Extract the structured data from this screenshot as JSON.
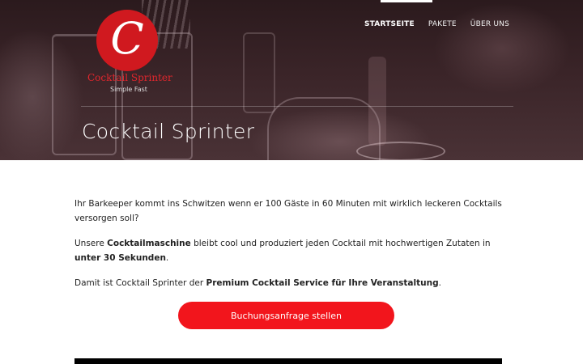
{
  "logo": {
    "letter": "C",
    "name": "Cocktail Sprinter",
    "tagline": "Simple Fast",
    "colors": {
      "circle": "#d0191f",
      "name": "#e0262d"
    }
  },
  "nav": {
    "items": [
      {
        "label": "STARTSEITE",
        "active": true
      },
      {
        "label": "PAKETE",
        "active": false
      },
      {
        "label": "ÜBER UNS",
        "active": false
      }
    ]
  },
  "hero": {
    "title": "Cocktail Sprinter"
  },
  "content": {
    "p1": "Ihr Barkeeper kommt ins Schwitzen wenn er 100 Gäste in 60 Minuten mit wirklich leckeren Cocktails versorgen soll?",
    "p2": {
      "a": "Unsere ",
      "b": "Cocktailmaschine",
      "c": " bleibt cool und produziert jeden Cocktail mit hochwertigen Zutaten in ",
      "d": "unter 30 Sekunden",
      "e": "."
    },
    "p3": {
      "a": "Damit ist Cocktail Sprinter der ",
      "b": "Premium Cocktail Service für Ihre Veranstaltung",
      "c": "."
    }
  },
  "cta": {
    "label": "Buchungsanfrage stellen",
    "color": "#f2151c"
  }
}
